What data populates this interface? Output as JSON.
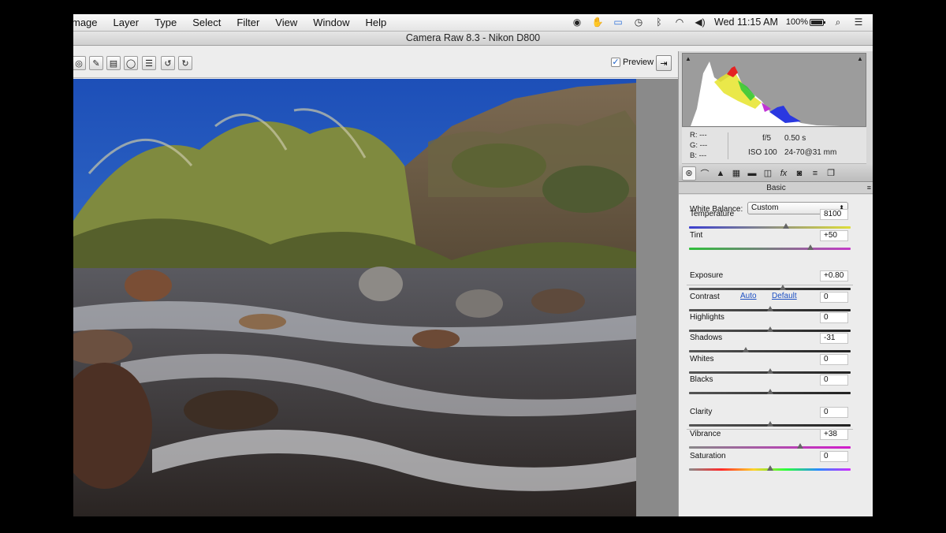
{
  "menubar": {
    "items": [
      "mage",
      "Layer",
      "Type",
      "Select",
      "Filter",
      "View",
      "Window",
      "Help"
    ],
    "clock": "Wed 11:15 AM",
    "battery": "100%"
  },
  "window": {
    "title": "Camera Raw 8.3  -  Nikon D800"
  },
  "toolbar": {
    "preview_label": "Preview",
    "preview_checked": "✓"
  },
  "info": {
    "r_label": "R:",
    "r_value": "---",
    "g_label": "G:",
    "g_value": "---",
    "b_label": "B:",
    "b_value": "---",
    "aperture": "f/5",
    "shutter": "0.50 s",
    "iso": "ISO 100",
    "lens": "24-70@31 mm"
  },
  "panel": {
    "section_title": "Basic",
    "white_balance_label": "White Balance:",
    "white_balance_value": "Custom",
    "auto_link": "Auto",
    "default_link": "Default",
    "sliders": [
      {
        "label": "Temperature",
        "value": "8100",
        "fraction": 0.6
      },
      {
        "label": "Tint",
        "value": "+50",
        "fraction": 0.75
      },
      {
        "label": "Exposure",
        "value": "+0.80",
        "fraction": 0.58
      },
      {
        "label": "Contrast",
        "value": "0",
        "fraction": 0.5
      },
      {
        "label": "Highlights",
        "value": "0",
        "fraction": 0.5
      },
      {
        "label": "Shadows",
        "value": "-31",
        "fraction": 0.35
      },
      {
        "label": "Whites",
        "value": "0",
        "fraction": 0.5
      },
      {
        "label": "Blacks",
        "value": "0",
        "fraction": 0.5
      },
      {
        "label": "Clarity",
        "value": "0",
        "fraction": 0.5
      },
      {
        "label": "Vibrance",
        "value": "+38",
        "fraction": 0.69
      },
      {
        "label": "Saturation",
        "value": "0",
        "fraction": 0.5
      }
    ]
  },
  "colors": {
    "temperature_track": [
      "#3b3fd0",
      "#dede3a"
    ],
    "tint_track": [
      "#2fbf3a",
      "#c43ac8"
    ],
    "vibrance_track": [
      "#888888",
      "#d21ccc"
    ],
    "saturation_track": [
      "#8a8a8a",
      "#ff2a2a",
      "#ffd12a",
      "#2aff3a",
      "#2a8aff",
      "#d22aff"
    ]
  }
}
